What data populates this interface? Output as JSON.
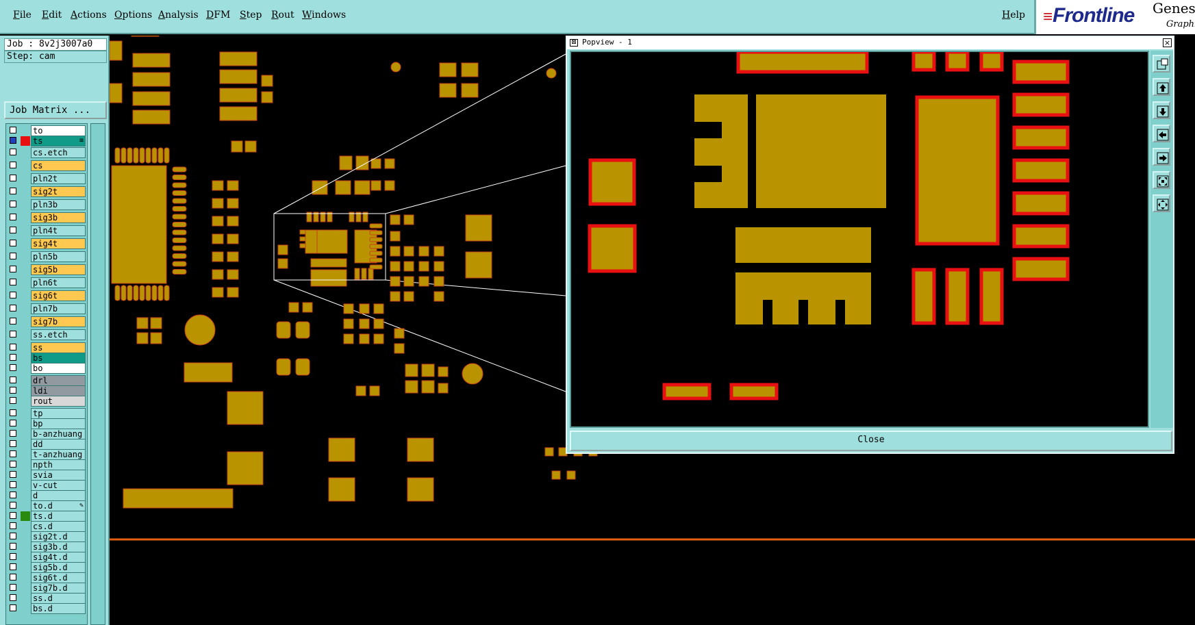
{
  "menu": {
    "items": [
      "File",
      "Edit",
      "Actions",
      "Options",
      "Analysis",
      "DFM",
      "Step",
      "Rout",
      "Windows"
    ],
    "help": "Help"
  },
  "brand": {
    "logo": "Frontline",
    "product": "Genesis",
    "sub": "Graphic"
  },
  "job": {
    "job_line": "Job : 8v2j3007a0",
    "step_line": "Step: cam",
    "matrix_button": "Job Matrix ..."
  },
  "layers": [
    {
      "name": "to",
      "bg": "#ffffff",
      "marker": "",
      "mark": ""
    },
    {
      "name": "ts",
      "bg": "#109a88",
      "marker": "#e81010",
      "mark": "≡"
    },
    {
      "name": "cs.etch",
      "bg": "#9fe0de",
      "marker": "",
      "mark": ""
    },
    {
      "name": "cs",
      "bg": "#ffc850",
      "marker": "",
      "mark": ""
    },
    {
      "name": "pln2t",
      "bg": "#9fe0de",
      "marker": "",
      "mark": ""
    },
    {
      "name": "sig2t",
      "bg": "#ffc850",
      "marker": "",
      "mark": ""
    },
    {
      "name": "pln3b",
      "bg": "#9fe0de",
      "marker": "",
      "mark": ""
    },
    {
      "name": "sig3b",
      "bg": "#ffc850",
      "marker": "",
      "mark": ""
    },
    {
      "name": "pln4t",
      "bg": "#9fe0de",
      "marker": "",
      "mark": ""
    },
    {
      "name": "sig4t",
      "bg": "#ffc850",
      "marker": "",
      "mark": ""
    },
    {
      "name": "pln5b",
      "bg": "#9fe0de",
      "marker": "",
      "mark": ""
    },
    {
      "name": "sig5b",
      "bg": "#ffc850",
      "marker": "",
      "mark": ""
    },
    {
      "name": "pln6t",
      "bg": "#9fe0de",
      "marker": "",
      "mark": ""
    },
    {
      "name": "sig6t",
      "bg": "#ffc850",
      "marker": "",
      "mark": ""
    },
    {
      "name": "pln7b",
      "bg": "#9fe0de",
      "marker": "",
      "mark": ""
    },
    {
      "name": "sig7b",
      "bg": "#ffc850",
      "marker": "",
      "mark": ""
    },
    {
      "name": "ss.etch",
      "bg": "#9fe0de",
      "marker": "",
      "mark": ""
    },
    {
      "name": "ss",
      "bg": "#ffc850",
      "marker": "",
      "mark": ""
    },
    {
      "name": "bs",
      "bg": "#109a88",
      "marker": "",
      "mark": ""
    },
    {
      "name": "bo",
      "bg": "#ffffff",
      "marker": "",
      "mark": ""
    },
    {
      "name": "drl",
      "bg": "#909aa0",
      "marker": "",
      "mark": ""
    },
    {
      "name": "ldi",
      "bg": "#909aa0",
      "marker": "",
      "mark": ""
    },
    {
      "name": "rout",
      "bg": "#d8d8d8",
      "marker": "",
      "mark": ""
    },
    {
      "name": "tp",
      "bg": "#9fe0de",
      "marker": "",
      "mark": ""
    },
    {
      "name": "bp",
      "bg": "#9fe0de",
      "marker": "",
      "mark": ""
    },
    {
      "name": "b-anzhuang",
      "bg": "#9fe0de",
      "marker": "",
      "mark": ""
    },
    {
      "name": "dd",
      "bg": "#9fe0de",
      "marker": "",
      "mark": ""
    },
    {
      "name": "t-anzhuang",
      "bg": "#9fe0de",
      "marker": "",
      "mark": ""
    },
    {
      "name": "npth",
      "bg": "#9fe0de",
      "marker": "",
      "mark": ""
    },
    {
      "name": "svia",
      "bg": "#9fe0de",
      "marker": "",
      "mark": ""
    },
    {
      "name": "v-cut",
      "bg": "#9fe0de",
      "marker": "",
      "mark": ""
    },
    {
      "name": "d",
      "bg": "#9fe0de",
      "marker": "",
      "mark": ""
    },
    {
      "name": "to.d",
      "bg": "#9fe0de",
      "marker": "",
      "mark": "✎"
    },
    {
      "name": "ts.d",
      "bg": "#9fe0de",
      "marker": "#2a8a10",
      "mark": ""
    },
    {
      "name": "cs.d",
      "bg": "#9fe0de",
      "marker": "",
      "mark": ""
    },
    {
      "name": "sig2t.d",
      "bg": "#9fe0de",
      "marker": "",
      "mark": ""
    },
    {
      "name": "sig3b.d",
      "bg": "#9fe0de",
      "marker": "",
      "mark": ""
    },
    {
      "name": "sig4t.d",
      "bg": "#9fe0de",
      "marker": "",
      "mark": ""
    },
    {
      "name": "sig5b.d",
      "bg": "#9fe0de",
      "marker": "",
      "mark": ""
    },
    {
      "name": "sig6t.d",
      "bg": "#9fe0de",
      "marker": "",
      "mark": ""
    },
    {
      "name": "sig7b.d",
      "bg": "#9fe0de",
      "marker": "",
      "mark": ""
    },
    {
      "name": "ss.d",
      "bg": "#9fe0de",
      "marker": "",
      "mark": ""
    },
    {
      "name": "bs.d",
      "bg": "#9fe0de",
      "marker": "",
      "mark": ""
    }
  ],
  "popview": {
    "title": "Popview - 1",
    "close_label": "Close",
    "close_x": "×",
    "sys_icon": "⊠",
    "tools": [
      "zoom-in-icon",
      "arrow-up-icon",
      "arrow-down-icon",
      "arrow-left-icon",
      "arrow-right-icon",
      "fit-all-icon",
      "pan-icon"
    ]
  },
  "colors": {
    "pad": "#b99400",
    "pad_outline_highlight": "#e81010",
    "trace": "#e06010",
    "panel": "#9fe0de"
  }
}
